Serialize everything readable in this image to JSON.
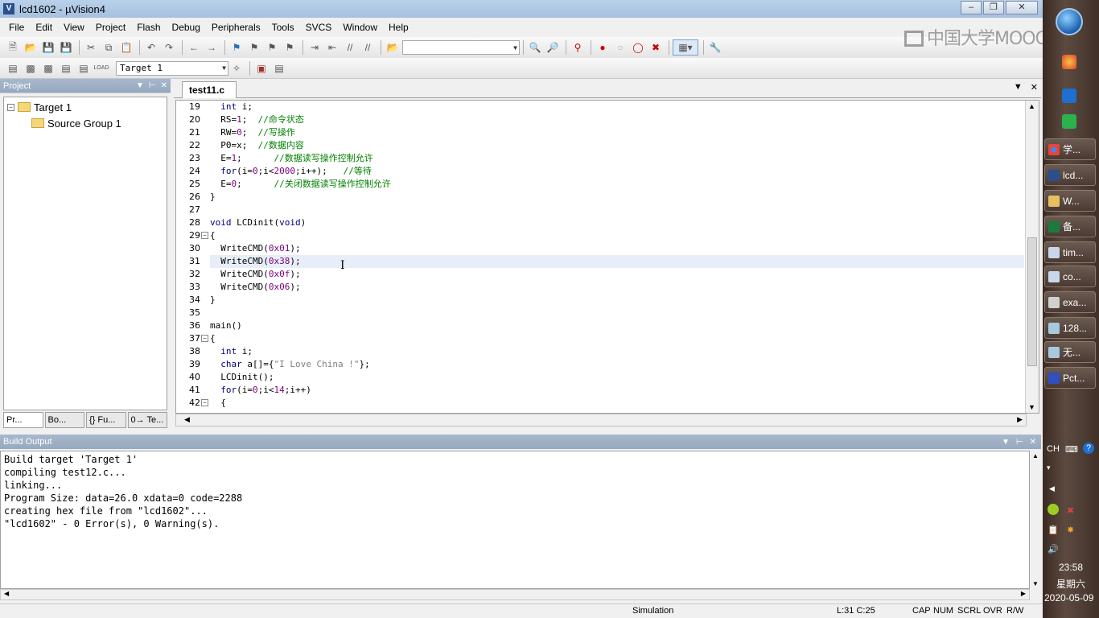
{
  "window": {
    "title": "lcd1602 - µVision4"
  },
  "menu": [
    "File",
    "Edit",
    "View",
    "Project",
    "Flash",
    "Debug",
    "Peripherals",
    "Tools",
    "SVCS",
    "Window",
    "Help"
  ],
  "toolbar": {
    "target_combo": "Target 1"
  },
  "project_pane": {
    "title": "Project",
    "tree": {
      "root": "Target 1",
      "child": "Source Group 1"
    },
    "tabs": [
      "Pr...",
      "Bo...",
      "{} Fu...",
      "0→ Te..."
    ]
  },
  "editor": {
    "tab": "test11.c",
    "lines": [
      {
        "n": "19",
        "text": "  int i;"
      },
      {
        "n": "20",
        "text": "  RS=1;  //命令状态"
      },
      {
        "n": "21",
        "text": "  RW=0;  //写操作"
      },
      {
        "n": "22",
        "text": "  P0=x;  //数据内容"
      },
      {
        "n": "23",
        "text": "  E=1;      //数据读写操作控制允许"
      },
      {
        "n": "24",
        "text": "  for(i=0;i<2000;i++);   //等待"
      },
      {
        "n": "25",
        "text": "  E=0;      //关闭数据读写操作控制允许"
      },
      {
        "n": "26",
        "text": "}"
      },
      {
        "n": "27",
        "text": ""
      },
      {
        "n": "28",
        "text": "void LCDinit(void)"
      },
      {
        "n": "29",
        "text": "{"
      },
      {
        "n": "30",
        "text": "  WriteCMD(0x01);"
      },
      {
        "n": "31",
        "text": "  WriteCMD(0x38);"
      },
      {
        "n": "32",
        "text": "  WriteCMD(0x0f);"
      },
      {
        "n": "33",
        "text": "  WriteCMD(0x06);"
      },
      {
        "n": "34",
        "text": "}"
      },
      {
        "n": "35",
        "text": ""
      },
      {
        "n": "36",
        "text": "main()"
      },
      {
        "n": "37",
        "text": "{"
      },
      {
        "n": "38",
        "text": "  int i;"
      },
      {
        "n": "39",
        "text": "  char a[]={\"I Love China !\"};"
      },
      {
        "n": "40",
        "text": "  LCDinit();"
      },
      {
        "n": "41",
        "text": "  for(i=0;i<14;i++)"
      },
      {
        "n": "42",
        "text": "  {"
      }
    ],
    "highlighted_line": "31"
  },
  "build_output": {
    "title": "Build Output",
    "lines": [
      "Build target 'Target 1'",
      "compiling test12.c...",
      "linking...",
      "Program Size: data=26.0 xdata=0 code=2288",
      "creating hex file from \"lcd1602\"...",
      "\"lcd1602\" - 0 Error(s), 0 Warning(s)."
    ]
  },
  "status": {
    "mode": "Simulation",
    "position": "L:31 C:25",
    "indicators": [
      "CAP",
      "NUM",
      "SCRL",
      "OVR",
      "R/W"
    ]
  },
  "taskbar": {
    "items": [
      "学...",
      "lcd...",
      "W...",
      "备...",
      "tim...",
      "co...",
      "exa...",
      "128...",
      "无...",
      "Pct..."
    ],
    "lang": "CH",
    "time": "23:58",
    "weekday": "星期六",
    "date": "2020-05-09"
  },
  "watermark": "中国大学MOOC",
  "colors": {
    "accent": "#a6c0de",
    "highlight_line": "#e8eef8",
    "comment": "#008000",
    "number": "#800080"
  }
}
